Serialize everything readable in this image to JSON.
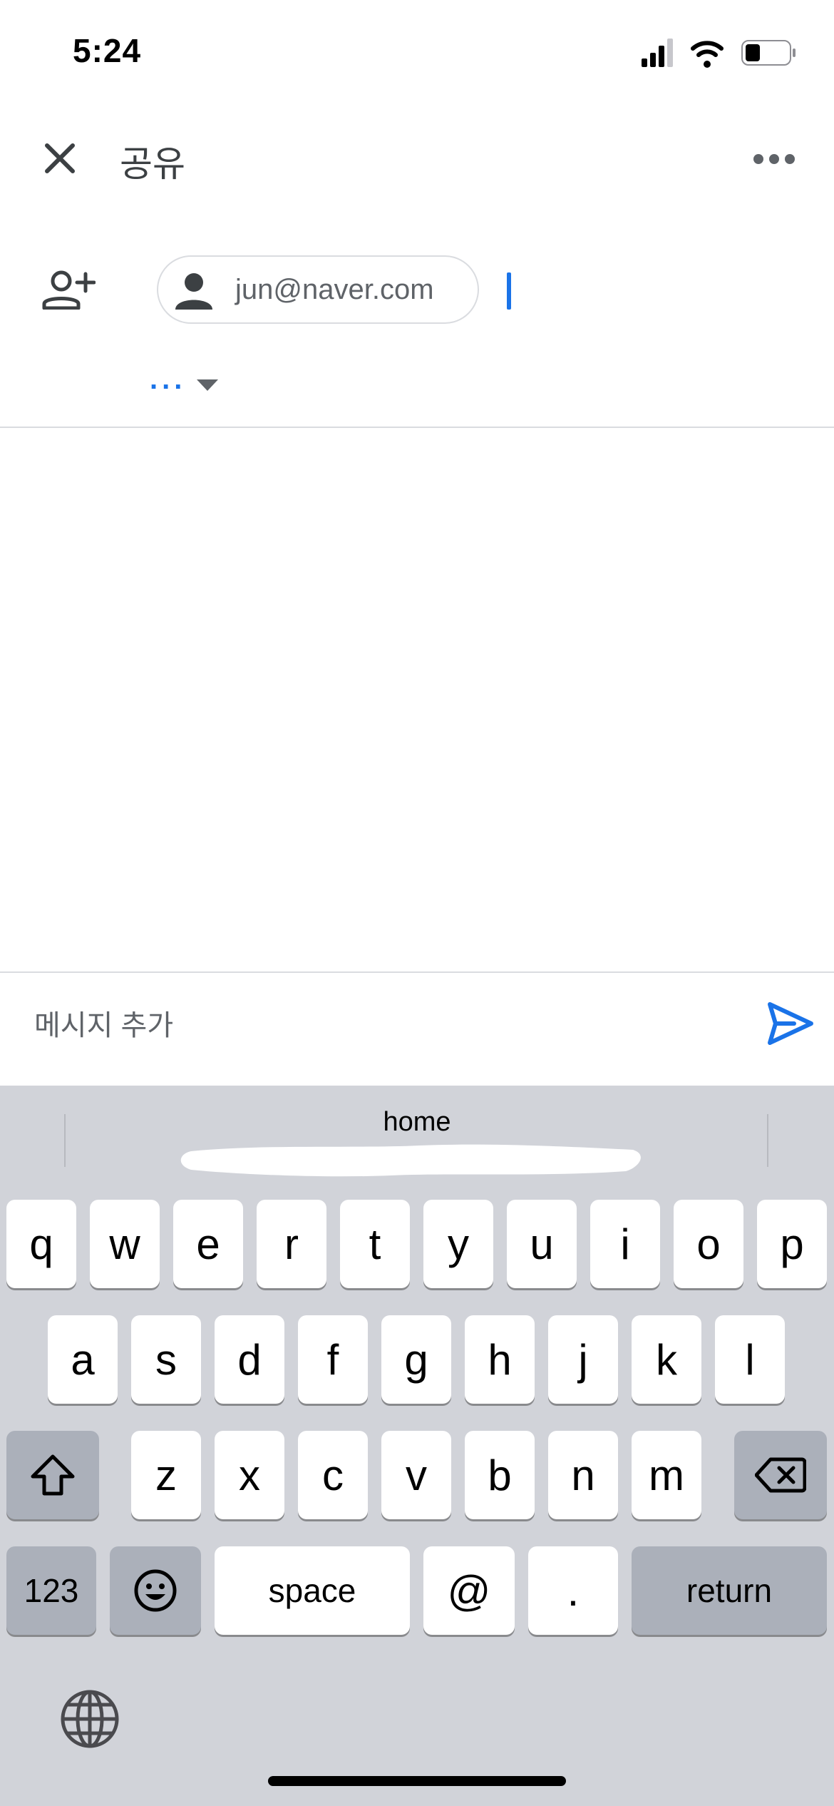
{
  "status_bar": {
    "time": "5:24"
  },
  "header": {
    "title": "공유"
  },
  "recipients": {
    "chip_email": "jun@naver.com",
    "role_label": "..."
  },
  "message": {
    "placeholder": "메시지 추가"
  },
  "keyboard": {
    "suggestion": "home",
    "row1": [
      "q",
      "w",
      "e",
      "r",
      "t",
      "y",
      "u",
      "i",
      "o",
      "p"
    ],
    "row2": [
      "a",
      "s",
      "d",
      "f",
      "g",
      "h",
      "j",
      "k",
      "l"
    ],
    "row3": [
      "z",
      "x",
      "c",
      "v",
      "b",
      "n",
      "m"
    ],
    "numbers_key": "123",
    "space_key": "space",
    "at_key": "@",
    "period_key": ".",
    "return_key": "return"
  },
  "icons": {
    "close": "close-icon",
    "more": "more-horizontal-icon",
    "add_person": "person-add-icon",
    "send": "send-icon",
    "shift": "shift-icon",
    "delete": "backspace-icon",
    "emoji": "emoji-icon",
    "globe": "globe-icon"
  },
  "colors": {
    "accent": "#1a73e8",
    "keyboard_bg": "#d1d3d9",
    "text_secondary": "#5f6368"
  }
}
